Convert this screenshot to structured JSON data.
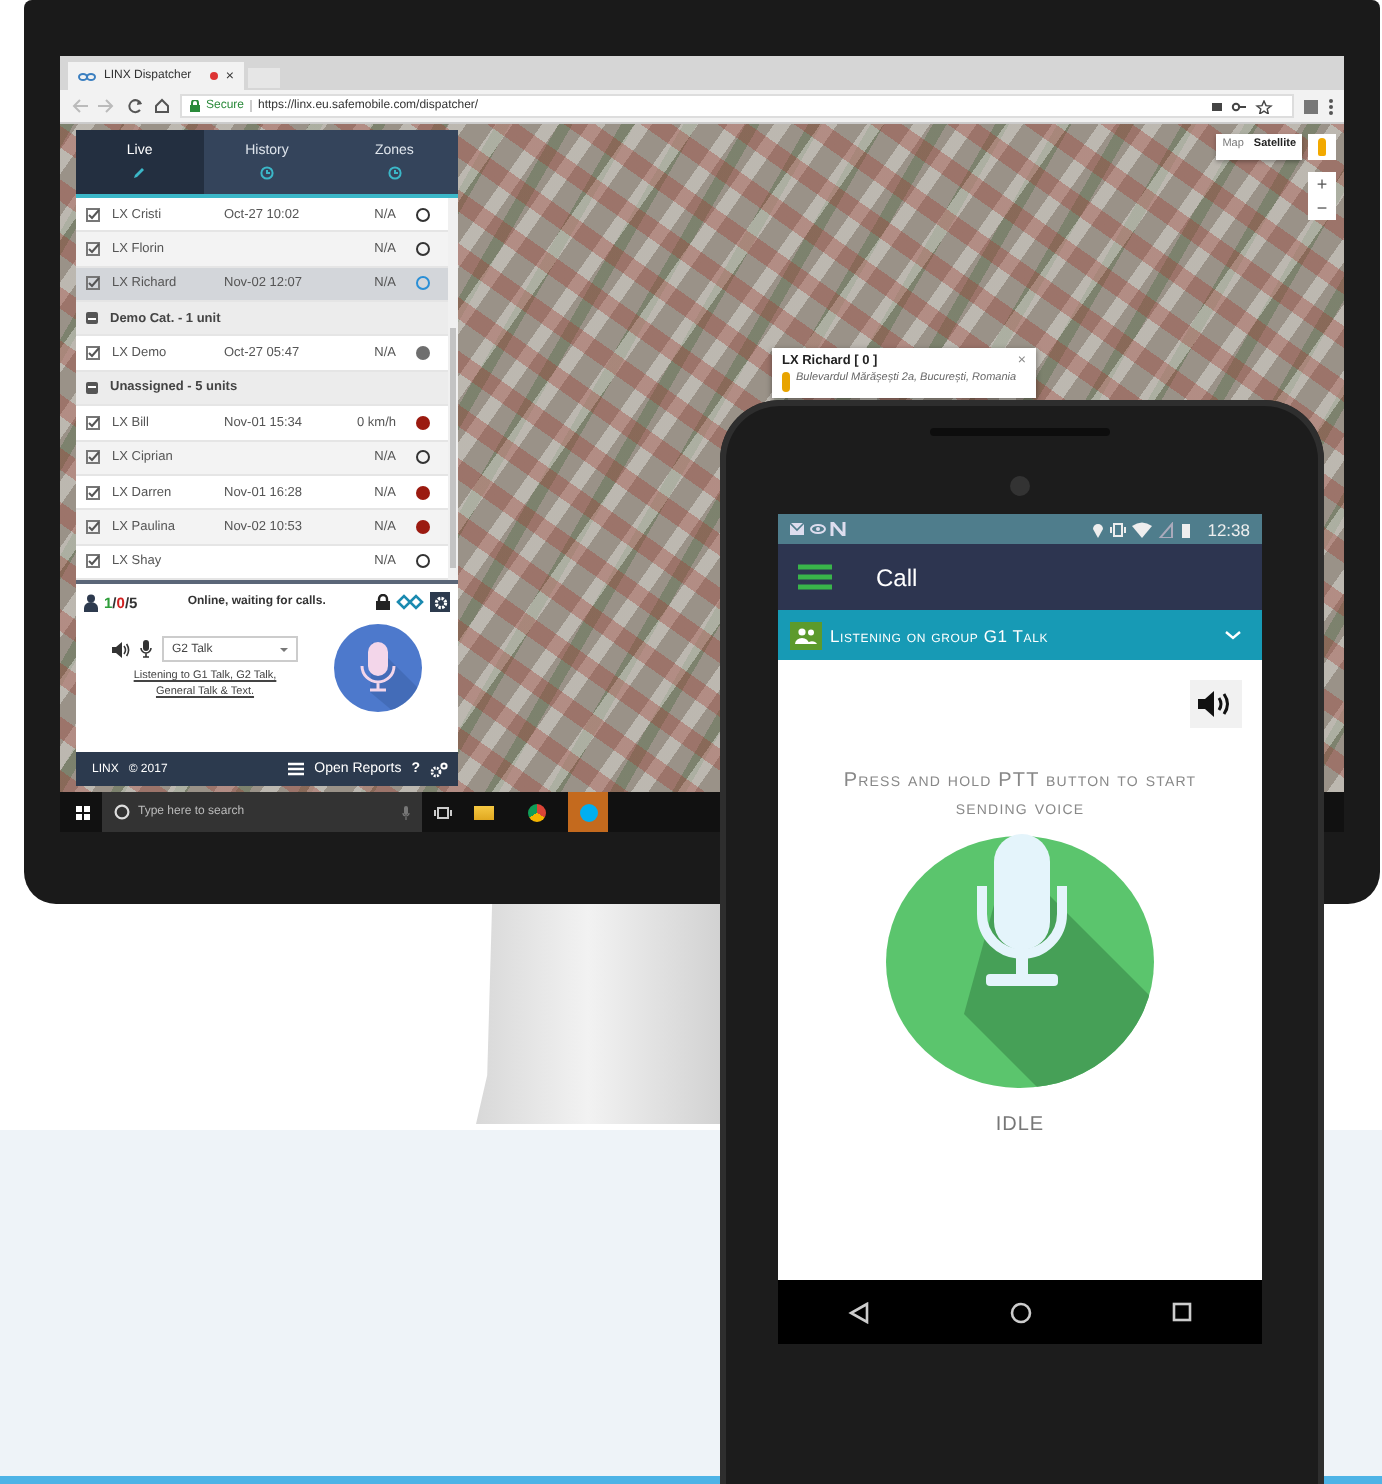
{
  "browser": {
    "tab_title": "LINX Dispatcher",
    "tab_close": "×",
    "secure": "Secure",
    "url": "https://linx.eu.safemobile.com/dispatcher/"
  },
  "side_tabs": [
    {
      "label": "Live",
      "selected": true
    },
    {
      "label": "History",
      "selected": false
    },
    {
      "label": "Zones",
      "selected": false
    }
  ],
  "units": [
    {
      "kind": "unit",
      "name": "LX Cristi",
      "time": "Oct-27 10:02",
      "speed": "N/A",
      "checked": true,
      "selected": false,
      "color": "#333333",
      "filled": false
    },
    {
      "kind": "unit",
      "name": "LX Florin",
      "speed": "N/A",
      "checked": true,
      "selected": false,
      "color": "#333333",
      "filled": false
    },
    {
      "kind": "unit",
      "name": "LX Richard",
      "time": "Nov-02 12:07",
      "speed": "N/A",
      "checked": true,
      "selected": true,
      "color": "#2a8fd6",
      "filled": false
    },
    {
      "kind": "group",
      "label": "Demo Cat. - 1 unit",
      "expanded": true
    },
    {
      "kind": "unit",
      "name": "LX Demo",
      "time": "Oct-27 05:47",
      "speed": "N/A",
      "checked": true,
      "selected": false,
      "color": "#6e6e6e",
      "filled": true
    },
    {
      "kind": "group",
      "label": "Unassigned - 5 units",
      "expanded": true
    },
    {
      "kind": "unit",
      "name": "LX Bill",
      "time": "Nov-01 15:34",
      "speed": "0 km/h",
      "checked": true,
      "selected": false,
      "color": "#9b1a10",
      "filled": true
    },
    {
      "kind": "unit",
      "name": "LX Ciprian",
      "speed": "N/A",
      "checked": true,
      "selected": false,
      "color": "#333333",
      "filled": false
    },
    {
      "kind": "unit",
      "name": "LX Darren",
      "time": "Nov-01 16:28",
      "speed": "N/A",
      "checked": true,
      "selected": false,
      "color": "#9b1a10",
      "filled": true
    },
    {
      "kind": "unit",
      "name": "LX Paulina",
      "time": "Nov-02 10:53",
      "speed": "N/A",
      "checked": true,
      "selected": false,
      "color": "#9b1a10",
      "filled": true
    },
    {
      "kind": "unit",
      "name": "LX Shay",
      "speed": "N/A",
      "checked": true,
      "selected": false,
      "color": "#333333",
      "filled": false
    }
  ],
  "counts": [
    {
      "value": "1",
      "color": "#2e9e3a"
    },
    {
      "value": "0",
      "color": "#d02020"
    },
    {
      "value": "5",
      "color": "#333333"
    }
  ],
  "count_separator": "/",
  "status_text": "Online, waiting for calls.",
  "talk_group": "G2 Talk",
  "listening": "Listening to G1 Talk, G2 Talk, General Talk & Text.",
  "bottom_bar": {
    "brand": "LINX",
    "copyright": "© 2017",
    "reports": "Open Reports",
    "help": "?"
  },
  "taskbar": {
    "search_placeholder": "Type here to search"
  },
  "map": {
    "types": [
      {
        "label": "Map",
        "selected": false
      },
      {
        "label": "Satellite",
        "selected": true
      }
    ],
    "zoom_in": "+",
    "zoom_out": "−",
    "popup": {
      "title": "LX Richard [ 0 ]",
      "address": "Bulevardul Mărășești 2a, București, Romania",
      "close": "×"
    }
  },
  "phone": {
    "time": "12:38",
    "title": "Call",
    "group": "Listening on group G1 Talk",
    "prompt": "Press and hold PTT button to start sending voice",
    "state": "IDLE"
  }
}
